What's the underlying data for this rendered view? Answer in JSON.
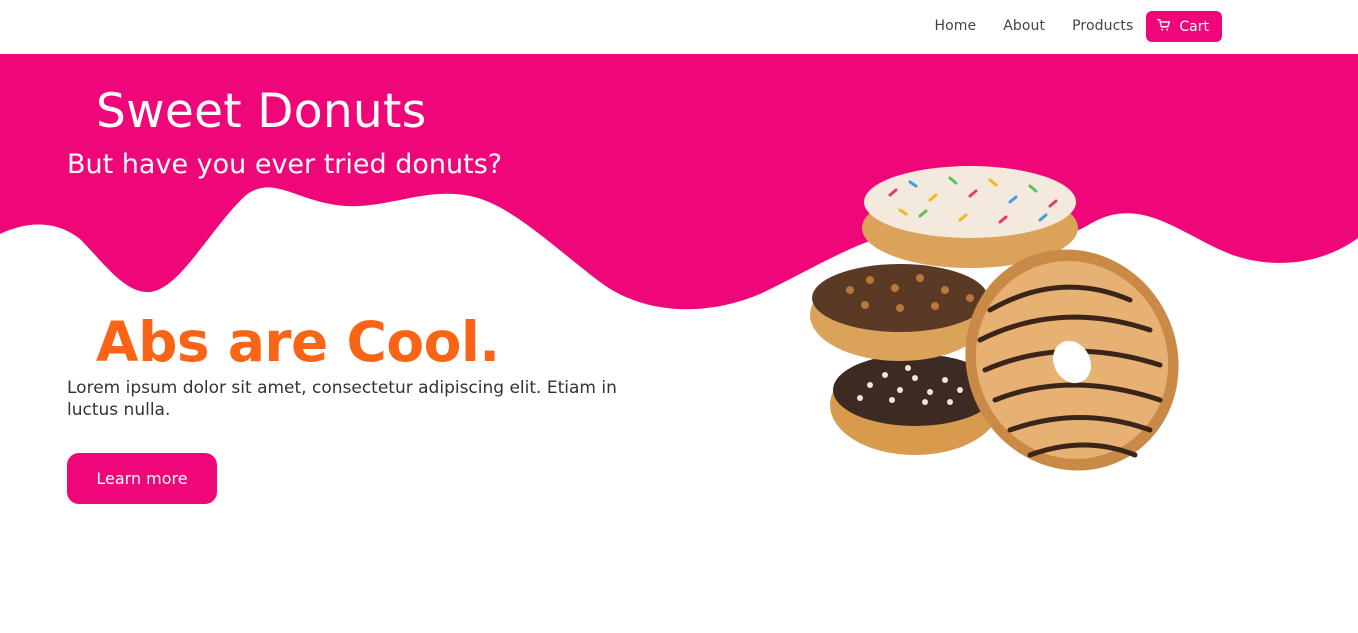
{
  "nav": {
    "items": [
      {
        "label": "Home"
      },
      {
        "label": "About"
      },
      {
        "label": "Products"
      }
    ],
    "cart_label": "Cart",
    "cart_icon": "cart-icon"
  },
  "hero": {
    "title": "Sweet Donuts",
    "subtitle": "But have you ever tried donuts?"
  },
  "main": {
    "headline": "Abs are Cool.",
    "body": "Lorem ipsum dolor sit amet, consectetur adipiscing elit. Etiam in luctus nulla.",
    "button_label": "Learn more"
  },
  "colors": {
    "brand_pink": "#ef0679",
    "headline_orange": "#fa6417",
    "background": "#ffffff"
  }
}
